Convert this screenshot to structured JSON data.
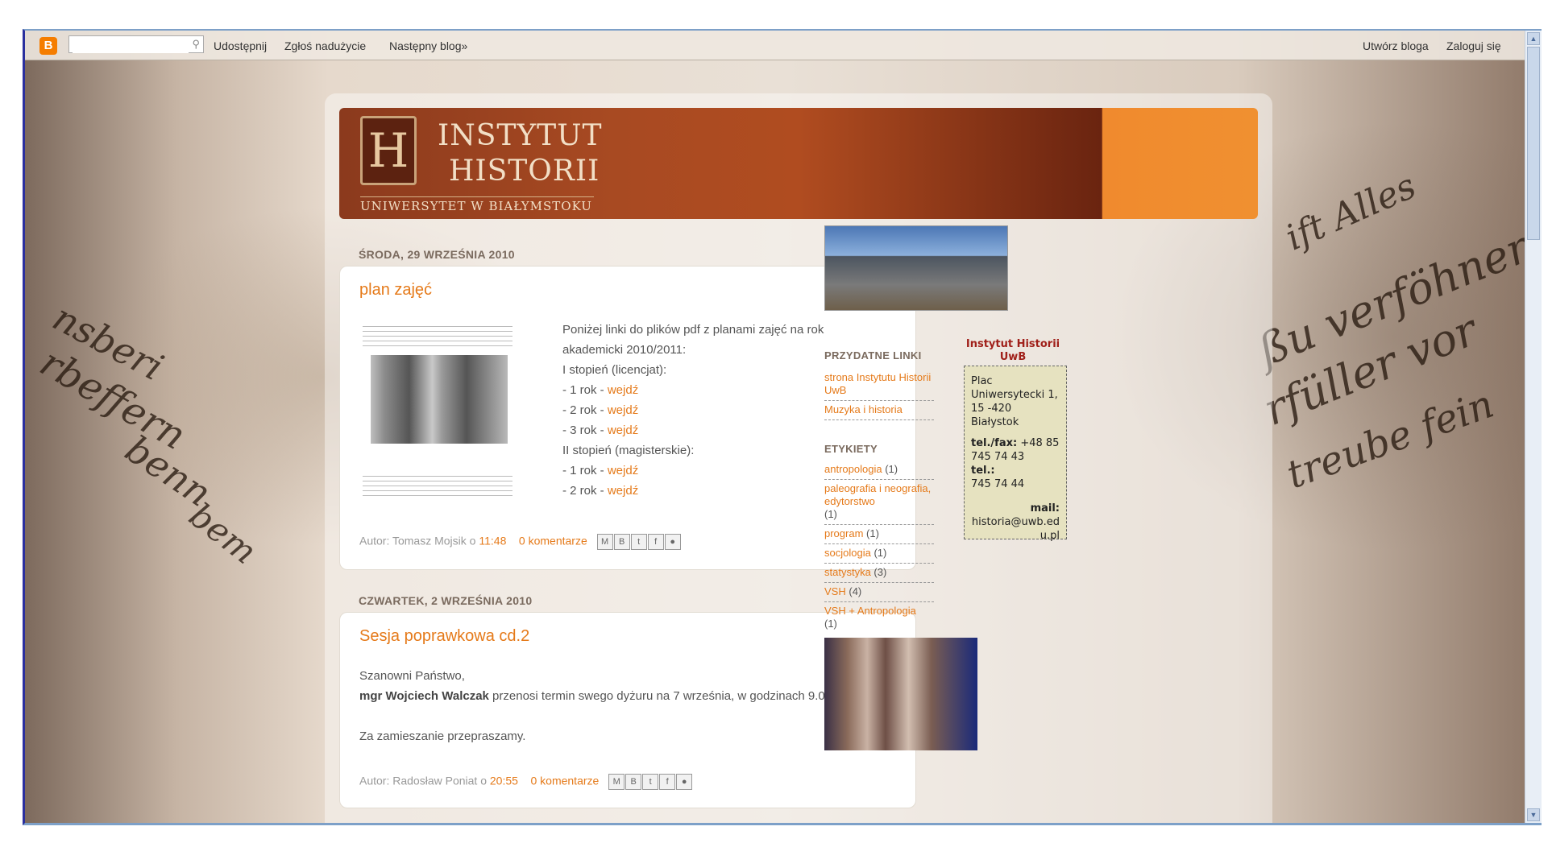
{
  "navbar": {
    "search_placeholder": "",
    "links_left": [
      "Udostępnij",
      "Zgłoś nadużycie",
      "Następny blog»"
    ],
    "links_right": [
      "Utwórz bloga",
      "Zaloguj się"
    ]
  },
  "header": {
    "line1": "INSTYTUT",
    "line2": "HISTORII",
    "subtitle": "UNIWERSYTET W BIAŁYMSTOKU",
    "logo_letter": "H"
  },
  "posts": [
    {
      "date": "ŚRODA, 29 WRZEŚNIA 2010",
      "title": "plan zajęć",
      "body": {
        "intro": "Poniżej linki do plików pdf z planami zajęć na rok akademicki 2010/2011:",
        "level1": "I stopień (licencjat):",
        "items1": [
          {
            "prefix": "- 1 rok - ",
            "link": "wejdź"
          },
          {
            "prefix": "- 2 rok - ",
            "link": "wejdź"
          },
          {
            "prefix": "- 3 rok - ",
            "link": "wejdź"
          }
        ],
        "level2": "II stopień (magisterskie):",
        "items2": [
          {
            "prefix": "- 1 rok - ",
            "link": "wejdź"
          },
          {
            "prefix": "- 2 rok - ",
            "link": "wejdź"
          }
        ]
      },
      "footer": {
        "author": "Autor: Tomasz Mojsik o ",
        "time": "11:48",
        "comments": "0 komentarze"
      }
    },
    {
      "date": "CZWARTEK, 2 WRZEŚNIA 2010",
      "title": "Sesja poprawkowa cd.2",
      "body": {
        "greeting": "Szanowni Państwo,",
        "name": "mgr Wojciech Walczak",
        "text": " przenosi termin swego dyżuru na 7 września, w godzinach 9.00-12.00.",
        "apology": "Za zamieszanie przepraszamy."
      },
      "footer": {
        "author": "Autor: Radosław Poniat o ",
        "time": "20:55",
        "comments": "0 komentarze"
      }
    }
  ],
  "sidebar": {
    "links_heading": "PRZYDATNE LINKI",
    "links": [
      "strona Instytutu Historii UwB",
      "Muzyka i historia"
    ],
    "labels_heading": "ETYKIETY",
    "labels": [
      {
        "name": "antropologia",
        "count": "(1)"
      },
      {
        "name": "paleografia i neografia, edytorstwo",
        "count": "(1)"
      },
      {
        "name": "program",
        "count": "(1)"
      },
      {
        "name": "socjologia",
        "count": "(1)"
      },
      {
        "name": "statystyka",
        "count": "(3)"
      },
      {
        "name": "VSH",
        "count": "(4)"
      },
      {
        "name": "VSH + Antropologia",
        "count": "(1)"
      }
    ],
    "institute": {
      "title": "Instytut Historii UwB",
      "address": "Plac Uniwersytecki 1, 15 -420 Białystok",
      "telfax_label": "tel./fax:",
      "telfax": " +48 85 745 74 43",
      "tel_label": "tel.:",
      "tel": "745 74 44",
      "mail_label": "mail:",
      "mail": "historia@uwb.edu.pl"
    }
  },
  "share_icons": [
    "email-icon",
    "blogger-icon",
    "twitter-icon",
    "facebook-icon",
    "buzz-icon"
  ]
}
